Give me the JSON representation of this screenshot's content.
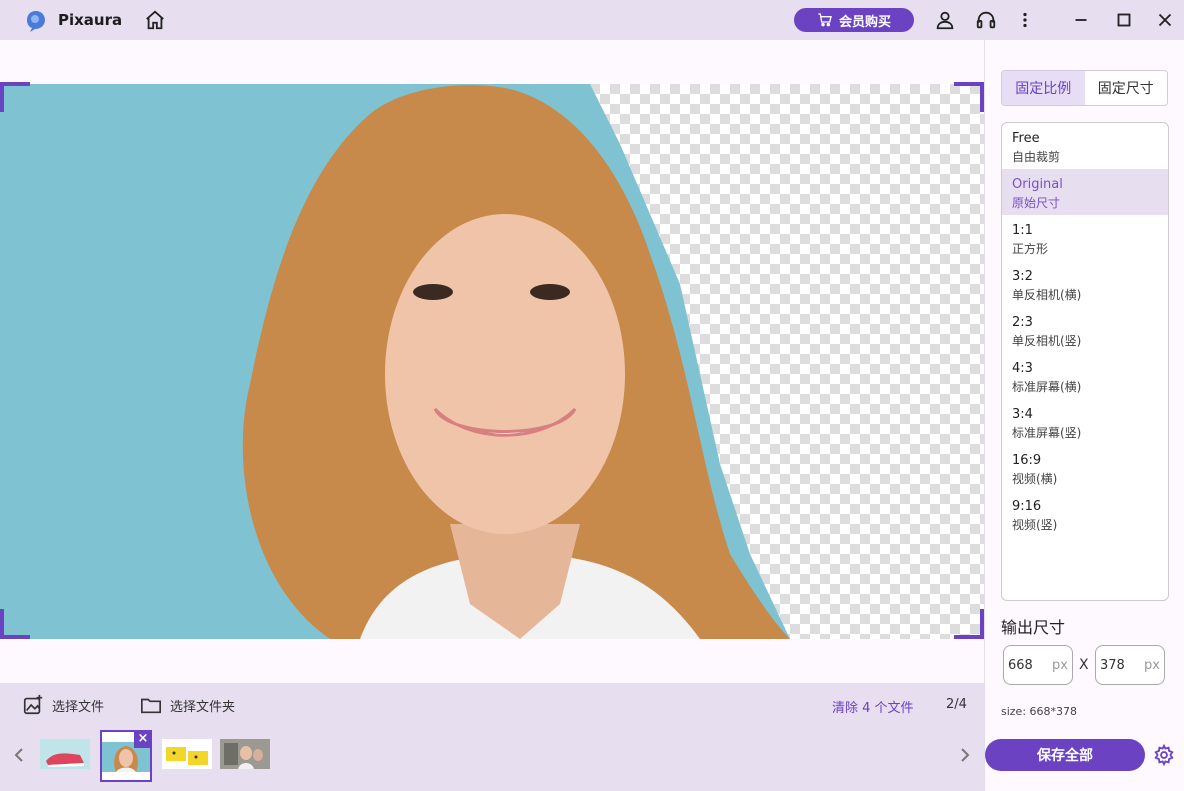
{
  "app": {
    "title": "Pixaura"
  },
  "header": {
    "vip_label": "会员购买"
  },
  "file_bar": {
    "select_file": "选择文件",
    "select_folder": "选择文件夹",
    "clear_label": "清除 4 个文件",
    "page_indicator": "2/4",
    "close_glyph": "×"
  },
  "right_panel": {
    "tabs": [
      "固定比例",
      "固定尺寸"
    ],
    "active_tab": 0,
    "ratios": [
      {
        "label": "Free",
        "sub": "自由裁剪"
      },
      {
        "label": "Original",
        "sub": "原始尺寸"
      },
      {
        "label": "1:1",
        "sub": "正方形"
      },
      {
        "label": "3:2",
        "sub": "单反相机(横)"
      },
      {
        "label": "2:3",
        "sub": "单反相机(竖)"
      },
      {
        "label": "4:3",
        "sub": "标准屏幕(横)"
      },
      {
        "label": "3:4",
        "sub": "标准屏幕(竖)"
      },
      {
        "label": "16:9",
        "sub": "视频(横)"
      },
      {
        "label": "9:16",
        "sub": "视频(竖)"
      }
    ],
    "selected_ratio": 1,
    "output_title": "输出尺寸",
    "width_value": "668",
    "height_value": "378",
    "unit": "px",
    "times": "X",
    "size_info": "size: 668*378",
    "save_all": "保存全部"
  },
  "colors": {
    "accent": "#6a42c2",
    "panel_bg": "#e7def0",
    "photo_bg": "#7fc3d3"
  },
  "icons": [
    "app-logo-icon",
    "home-icon",
    "cart-icon",
    "user-icon",
    "headset-icon",
    "more-icon",
    "minimize-icon",
    "maximize-icon",
    "close-icon",
    "add-image-icon",
    "folder-icon",
    "chevron-left-icon",
    "chevron-right-icon",
    "gear-icon"
  ]
}
